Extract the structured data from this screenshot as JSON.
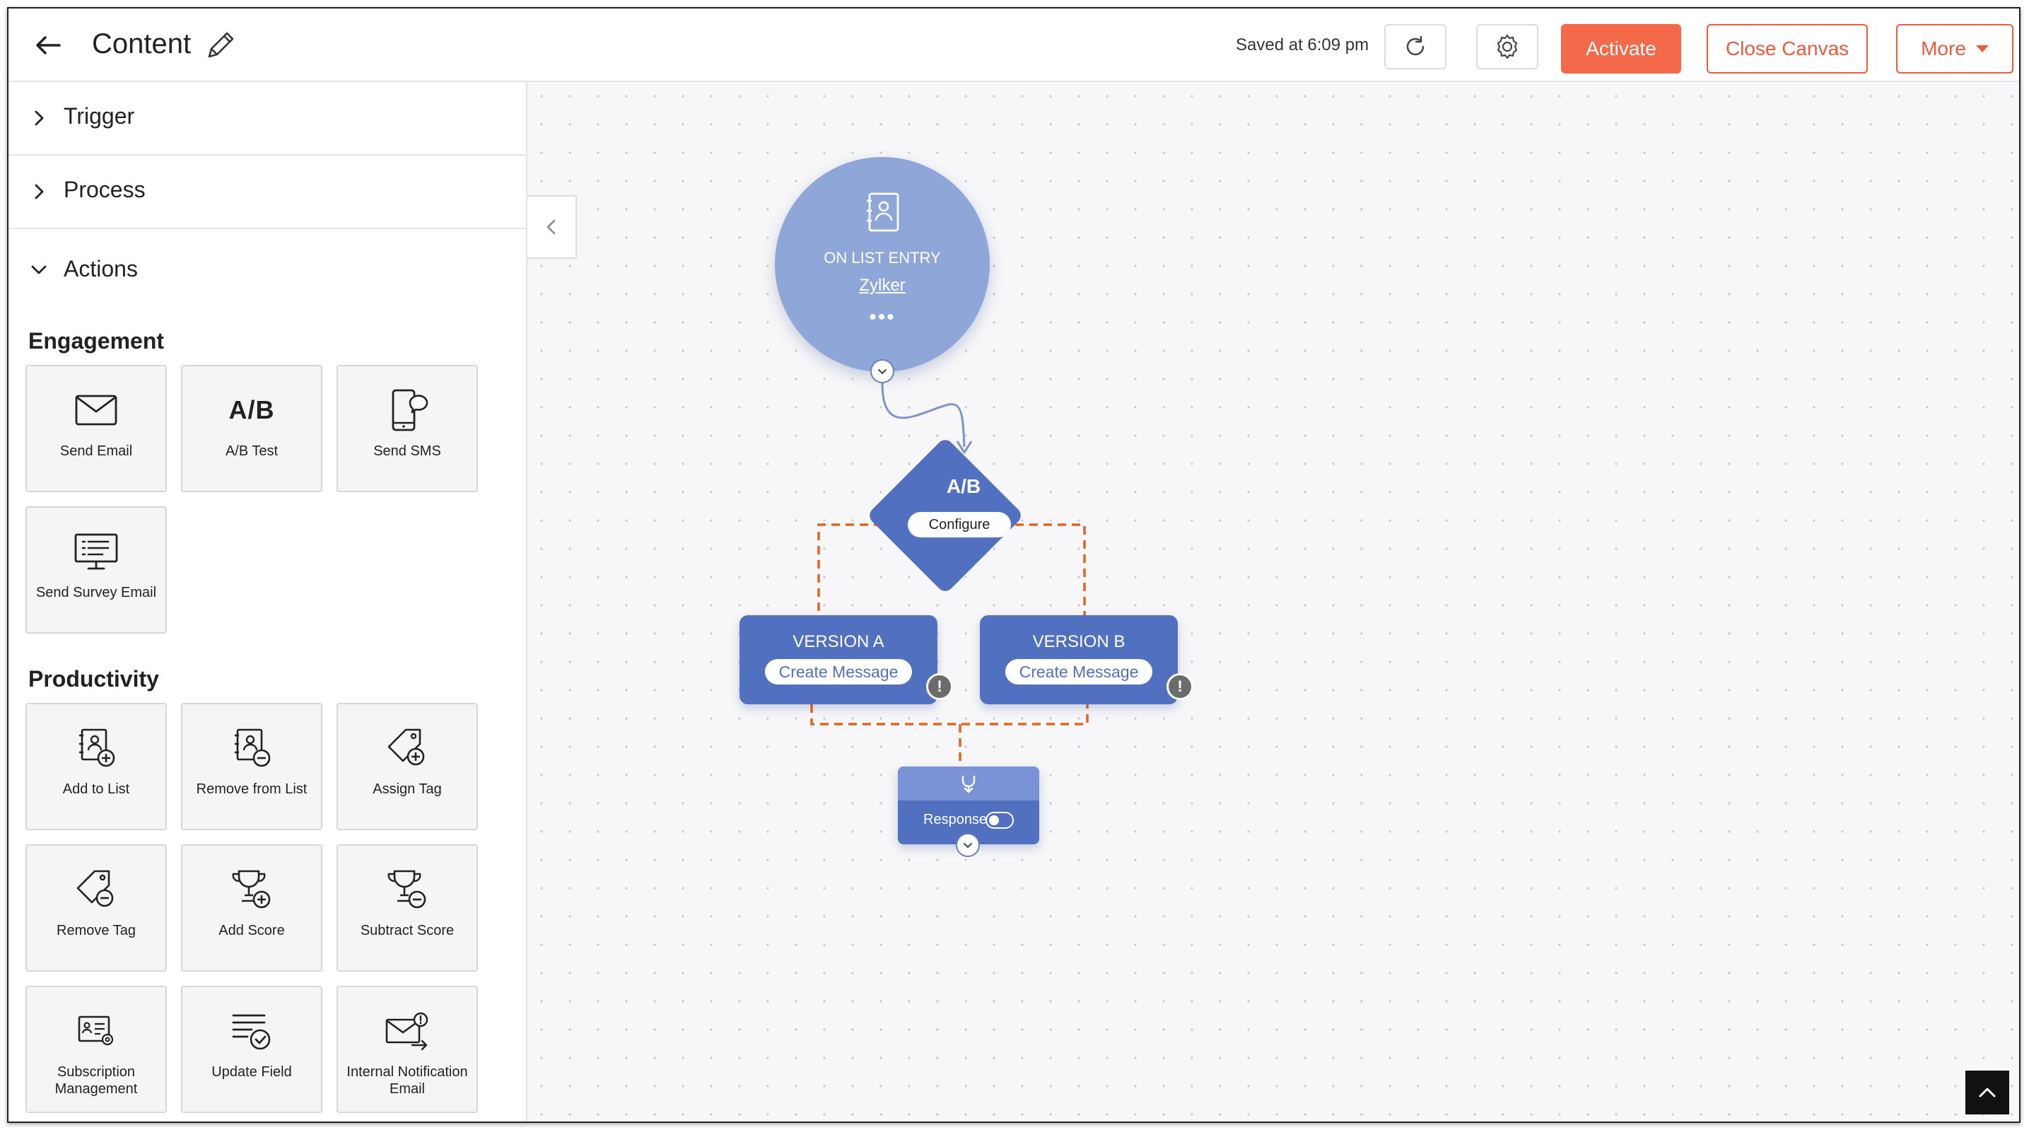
{
  "header": {
    "title": "Content",
    "saved_text": "Saved at 6:09 pm",
    "activate_label": "Activate",
    "close_canvas_label": "Close Canvas",
    "more_label": "More"
  },
  "sidebar": {
    "accordions": [
      {
        "label": "Trigger",
        "state": "collapsed"
      },
      {
        "label": "Process",
        "state": "collapsed"
      },
      {
        "label": "Actions",
        "state": "expanded"
      }
    ],
    "sections": {
      "engagement": {
        "title": "Engagement",
        "items": [
          {
            "label": "Send Email",
            "icon": "envelope-icon"
          },
          {
            "label": "A/B Test",
            "icon": "ab-test-icon",
            "icon_text": "A/B"
          },
          {
            "label": "Send SMS",
            "icon": "mobile-sms-icon"
          },
          {
            "label": "Send Survey Email",
            "icon": "survey-monitor-icon"
          }
        ]
      },
      "productivity": {
        "title": "Productivity",
        "items": [
          {
            "label": "Add to List",
            "icon": "add-contact-list-icon"
          },
          {
            "label": "Remove from List",
            "icon": "remove-contact-list-icon"
          },
          {
            "label": "Assign Tag",
            "icon": "tag-add-icon"
          },
          {
            "label": "Remove Tag",
            "icon": "tag-remove-icon"
          },
          {
            "label": "Add Score",
            "icon": "trophy-add-icon"
          },
          {
            "label": "Subtract Score",
            "icon": "trophy-subtract-icon"
          },
          {
            "label": "Subscription Management",
            "icon": "subscription-card-icon"
          },
          {
            "label": "Update Field",
            "icon": "update-field-icon"
          },
          {
            "label": "Internal Notification Email",
            "icon": "notification-email-icon"
          }
        ]
      }
    }
  },
  "canvas": {
    "trigger_node": {
      "title": "ON LIST ENTRY",
      "link": "Zylker",
      "more": "•••"
    },
    "ab_node": {
      "label": "A/B",
      "configure_label": "Configure"
    },
    "versions": [
      {
        "title": "VERSION A",
        "button": "Create Message",
        "warning": "!"
      },
      {
        "title": "VERSION B",
        "button": "Create Message",
        "warning": "!"
      }
    ],
    "response_node": {
      "label": "Response",
      "toggle": "off"
    }
  },
  "colors": {
    "accent": "#f3694a",
    "node_primary": "#5270c0",
    "node_trigger": "#8fa6d8",
    "branch_line": "#e8621f"
  }
}
